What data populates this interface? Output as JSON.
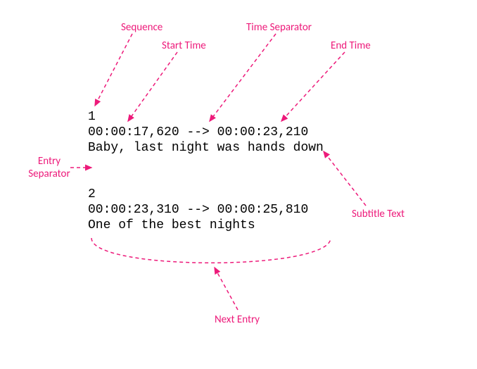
{
  "labels": {
    "sequence": "Sequence",
    "start_time": "Start Time",
    "time_separator": "Time Separator",
    "end_time": "End Time",
    "entry_separator": "Entry Separator",
    "subtitle_text": "Subtitle Text",
    "next_entry": "Next Entry"
  },
  "entries": [
    {
      "seq": "1",
      "start": "00:00:17,620",
      "sep": "-->",
      "end": "00:00:23,210",
      "text": "Baby, last night was hands down"
    },
    {
      "seq": "2",
      "start": "00:00:23,310",
      "sep": "-->",
      "end": "00:00:25,810",
      "text": "One of the best nights"
    }
  ]
}
